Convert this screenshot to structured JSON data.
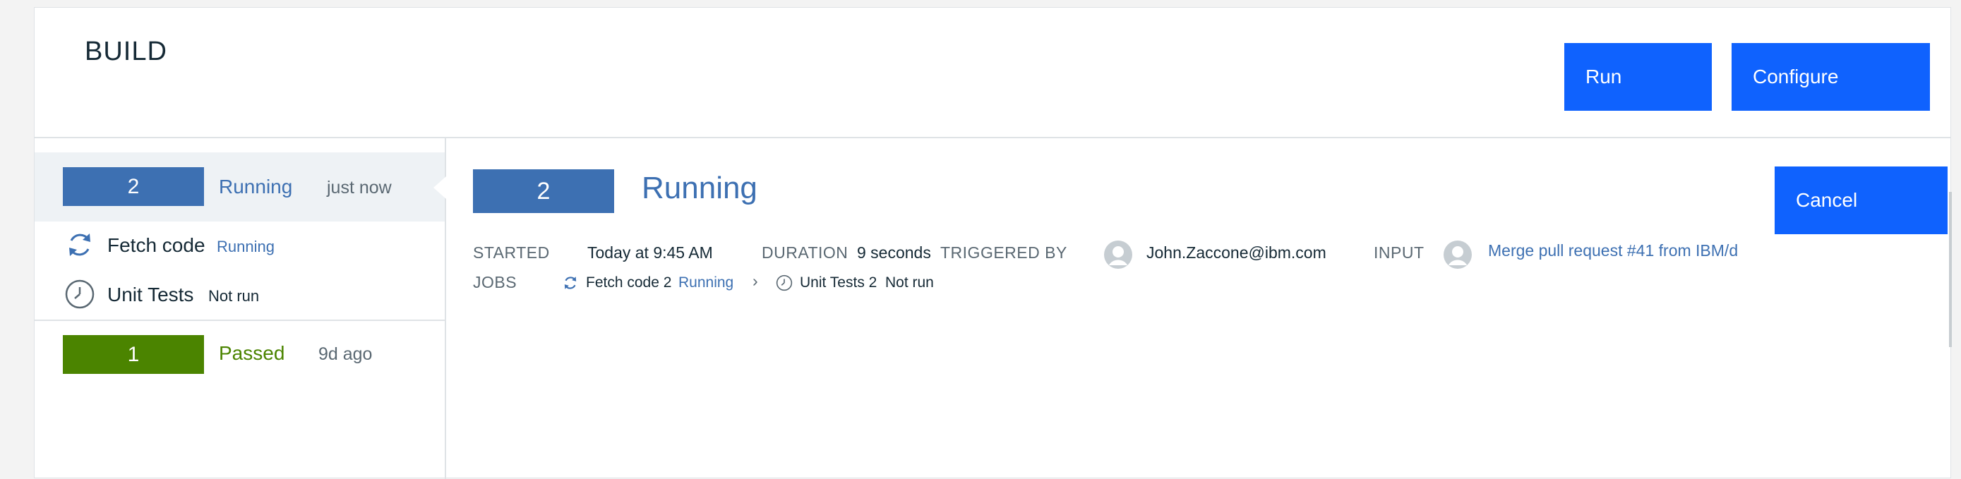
{
  "header": {
    "title": "BUILD",
    "run_label": "Run",
    "configure_label": "Configure"
  },
  "builds": [
    {
      "number": "2",
      "status": "Running",
      "time": "just now",
      "status_color": "#3d70b2",
      "badge_color": "#3d70b2",
      "jobs": [
        {
          "name": "Fetch code",
          "status": "Running",
          "icon": "sync-icon"
        },
        {
          "name": "Unit Tests",
          "status": "Not run",
          "icon": "clock-icon"
        }
      ]
    },
    {
      "number": "1",
      "status": "Passed",
      "time": "9d ago",
      "status_color": "#4b8400",
      "badge_color": "#4b8400"
    }
  ],
  "detail": {
    "number": "2",
    "status": "Running",
    "cancel_label": "Cancel",
    "started_key": "STARTED",
    "started_value": "Today at 9:45 AM",
    "duration_key": "DURATION",
    "duration_value": "9 seconds",
    "triggered_key": "TRIGGERED BY",
    "triggered_value": "John.Zaccone@ibm.com",
    "input_key": "INPUT",
    "input_value": "Merge pull request #41 from IBM/d",
    "jobs_key": "JOBS",
    "jobs": [
      {
        "name": "Fetch code 2",
        "status": "Running",
        "icon": "sync-icon"
      },
      {
        "name": "Unit Tests 2",
        "status": "Not run",
        "icon": "clock-icon"
      }
    ],
    "separator": "›"
  },
  "colors": {
    "primary_button": "#0f62fe",
    "running": "#3d70b2",
    "passed": "#4b8400",
    "link": "#3d70b2"
  }
}
